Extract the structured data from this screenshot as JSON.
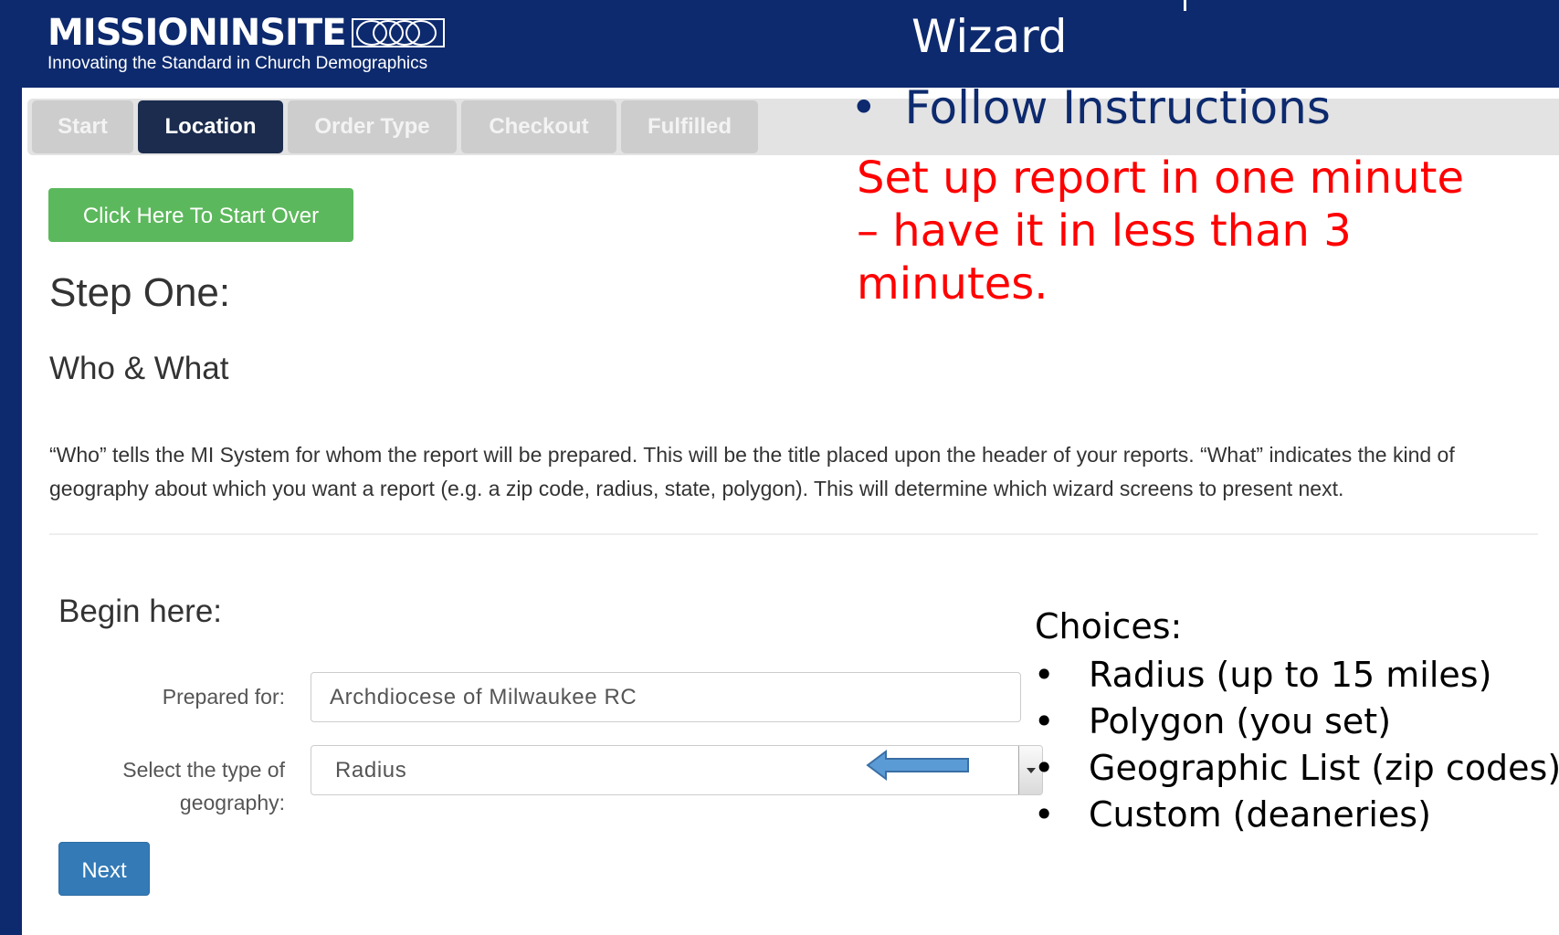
{
  "header": {
    "logo_text": "MISSIONINSITE",
    "logo_tagline": "Innovating the Standard in Church Demographics",
    "wizard_title": "Wizard"
  },
  "tabs": [
    {
      "label": "Start",
      "active": false
    },
    {
      "label": "Location",
      "active": true
    },
    {
      "label": "Order Type",
      "active": false
    },
    {
      "label": "Checkout",
      "active": false
    },
    {
      "label": "Fulfilled",
      "active": false
    }
  ],
  "annotation": {
    "bullet": "•",
    "instruction": "Follow Instructions",
    "note": "Set up report in one minute – have it in less than 3 minutes."
  },
  "main": {
    "start_over_label": "Click Here To Start Over",
    "step_title": "Step One:",
    "section_title": "Who & What",
    "description": "“Who” tells the MI System for whom the report will be prepared. This will be the title placed upon the header of your reports. “What” indicates the kind of geography about which you want a report (e.g. a zip code, radius, state, polygon). This will determine which wizard screens to present next.",
    "begin_here": "Begin here:"
  },
  "form": {
    "prepared_for_label": "Prepared for:",
    "prepared_for_value": "Archdiocese of Milwaukee RC",
    "geography_label": "Select the type of geography:",
    "geography_value": "Radius",
    "next_label": "Next"
  },
  "choices": {
    "title": "Choices:",
    "bullet": "•",
    "items": [
      "Radius (up to 15 miles)",
      "Polygon (you set)",
      "Geographic List (zip codes)",
      "Custom (deaneries)"
    ]
  },
  "colors": {
    "header_navy": "#0d2a6e",
    "active_tab": "#1b2c4e",
    "start_over_green": "#5cb85c",
    "next_blue": "#337ab7",
    "note_red": "#ff0000",
    "arrow_blue": "#5b9bd5"
  },
  "icons": {
    "logo_mark": "interlocking-rings-icon",
    "select_toggle": "caret-down-icon",
    "pointer": "left-arrow-icon"
  }
}
